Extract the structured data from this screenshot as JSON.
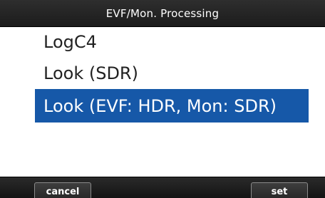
{
  "header": {
    "title": "EVF/Mon. Processing"
  },
  "list": {
    "items": [
      {
        "label": "LogC4",
        "selected": false
      },
      {
        "label": "Look (SDR)",
        "selected": false
      },
      {
        "label": "Look (EVF: HDR, Mon: SDR)",
        "selected": true
      }
    ]
  },
  "softkeys": {
    "cancel_label": "cancel",
    "set_label": "set"
  },
  "colors": {
    "selection": "#1658a8",
    "title_bar": "#1c1c1c",
    "list_background": "#ffffff"
  }
}
